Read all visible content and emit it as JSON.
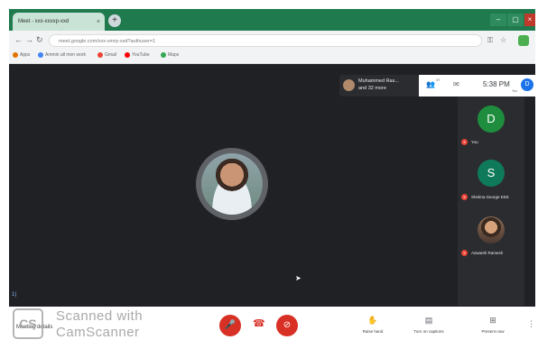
{
  "browser": {
    "tab_title": "Meet - xxx-xxxxp-xxd",
    "tab_close": "×",
    "new_tab": "+",
    "url": "meet.google.com/xxx-xmrp-xxd?authuser=1",
    "window_controls": {
      "minimize": "–",
      "maximize": "▢",
      "close": "×"
    },
    "bookmarks": [
      "Apps",
      "Ammin all mon work",
      "Gmail",
      "YouTube",
      "Maps"
    ]
  },
  "meet": {
    "presenting_chip": {
      "line1": "Muhammed Ras...",
      "line2": "and 32 more"
    },
    "topbar": {
      "people_badge": "37",
      "time": "5:38 PM",
      "self_initial": "D",
      "self_label": "You"
    },
    "participants": [
      {
        "initial": "D",
        "name": "You",
        "color": "#1e8e3e"
      },
      {
        "initial": "S",
        "name": "Shelma George EEE",
        "color": "#0f7a5a"
      },
      {
        "initial": "",
        "name": "Aswanth Ramesh",
        "color": ""
      }
    ],
    "bottom_left": "1)",
    "controls": {
      "meeting_details": "Meeting details",
      "raise_hand": "Raise hand",
      "captions": "Turn on captions",
      "present": "Present now"
    }
  },
  "watermark": {
    "logo": "CS",
    "line1": "Scanned with",
    "line2": "CamScanner"
  },
  "colors": {
    "accent_red": "#d93025",
    "chrome_green": "#1f7a4d",
    "meet_bg": "#202124"
  }
}
